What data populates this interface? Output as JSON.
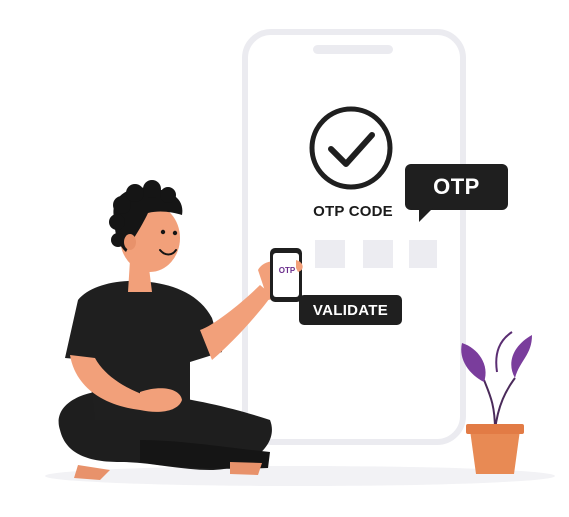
{
  "phone": {
    "heading": "OTP CODE",
    "otp_digits": [
      "",
      "",
      "",
      ""
    ],
    "validate_label": "VALIDATE",
    "status_icon": "checkmark-icon"
  },
  "bubble": {
    "label": "OTP"
  },
  "handheld_phone": {
    "screen_label": "OTP"
  },
  "colors": {
    "primary_dark": "#1f1f1f",
    "accent_purple": "#6a2d8c",
    "skin": "#f2a07a",
    "pot": "#e88a54",
    "phone_frame": "#efeef3"
  }
}
